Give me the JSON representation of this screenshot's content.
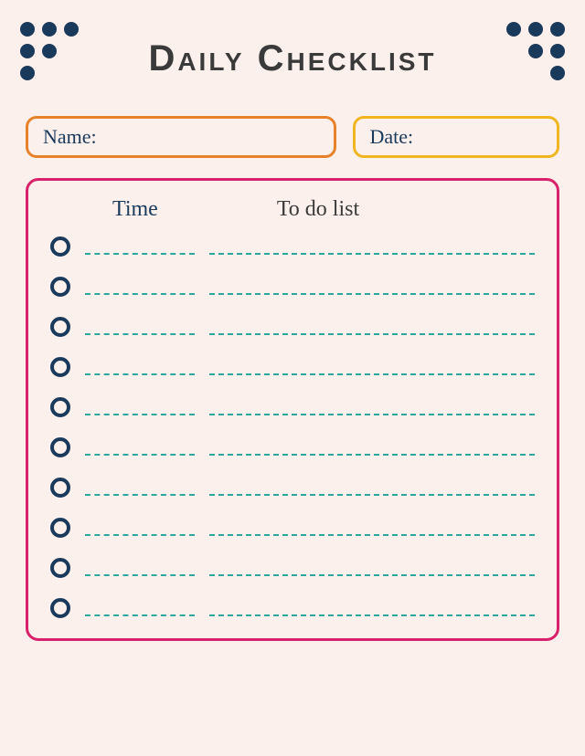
{
  "title": "Daily Checklist",
  "fields": {
    "name_label": "Name:",
    "date_label": "Date:"
  },
  "headers": {
    "time": "Time",
    "todo": "To do list"
  },
  "row_count": 10
}
